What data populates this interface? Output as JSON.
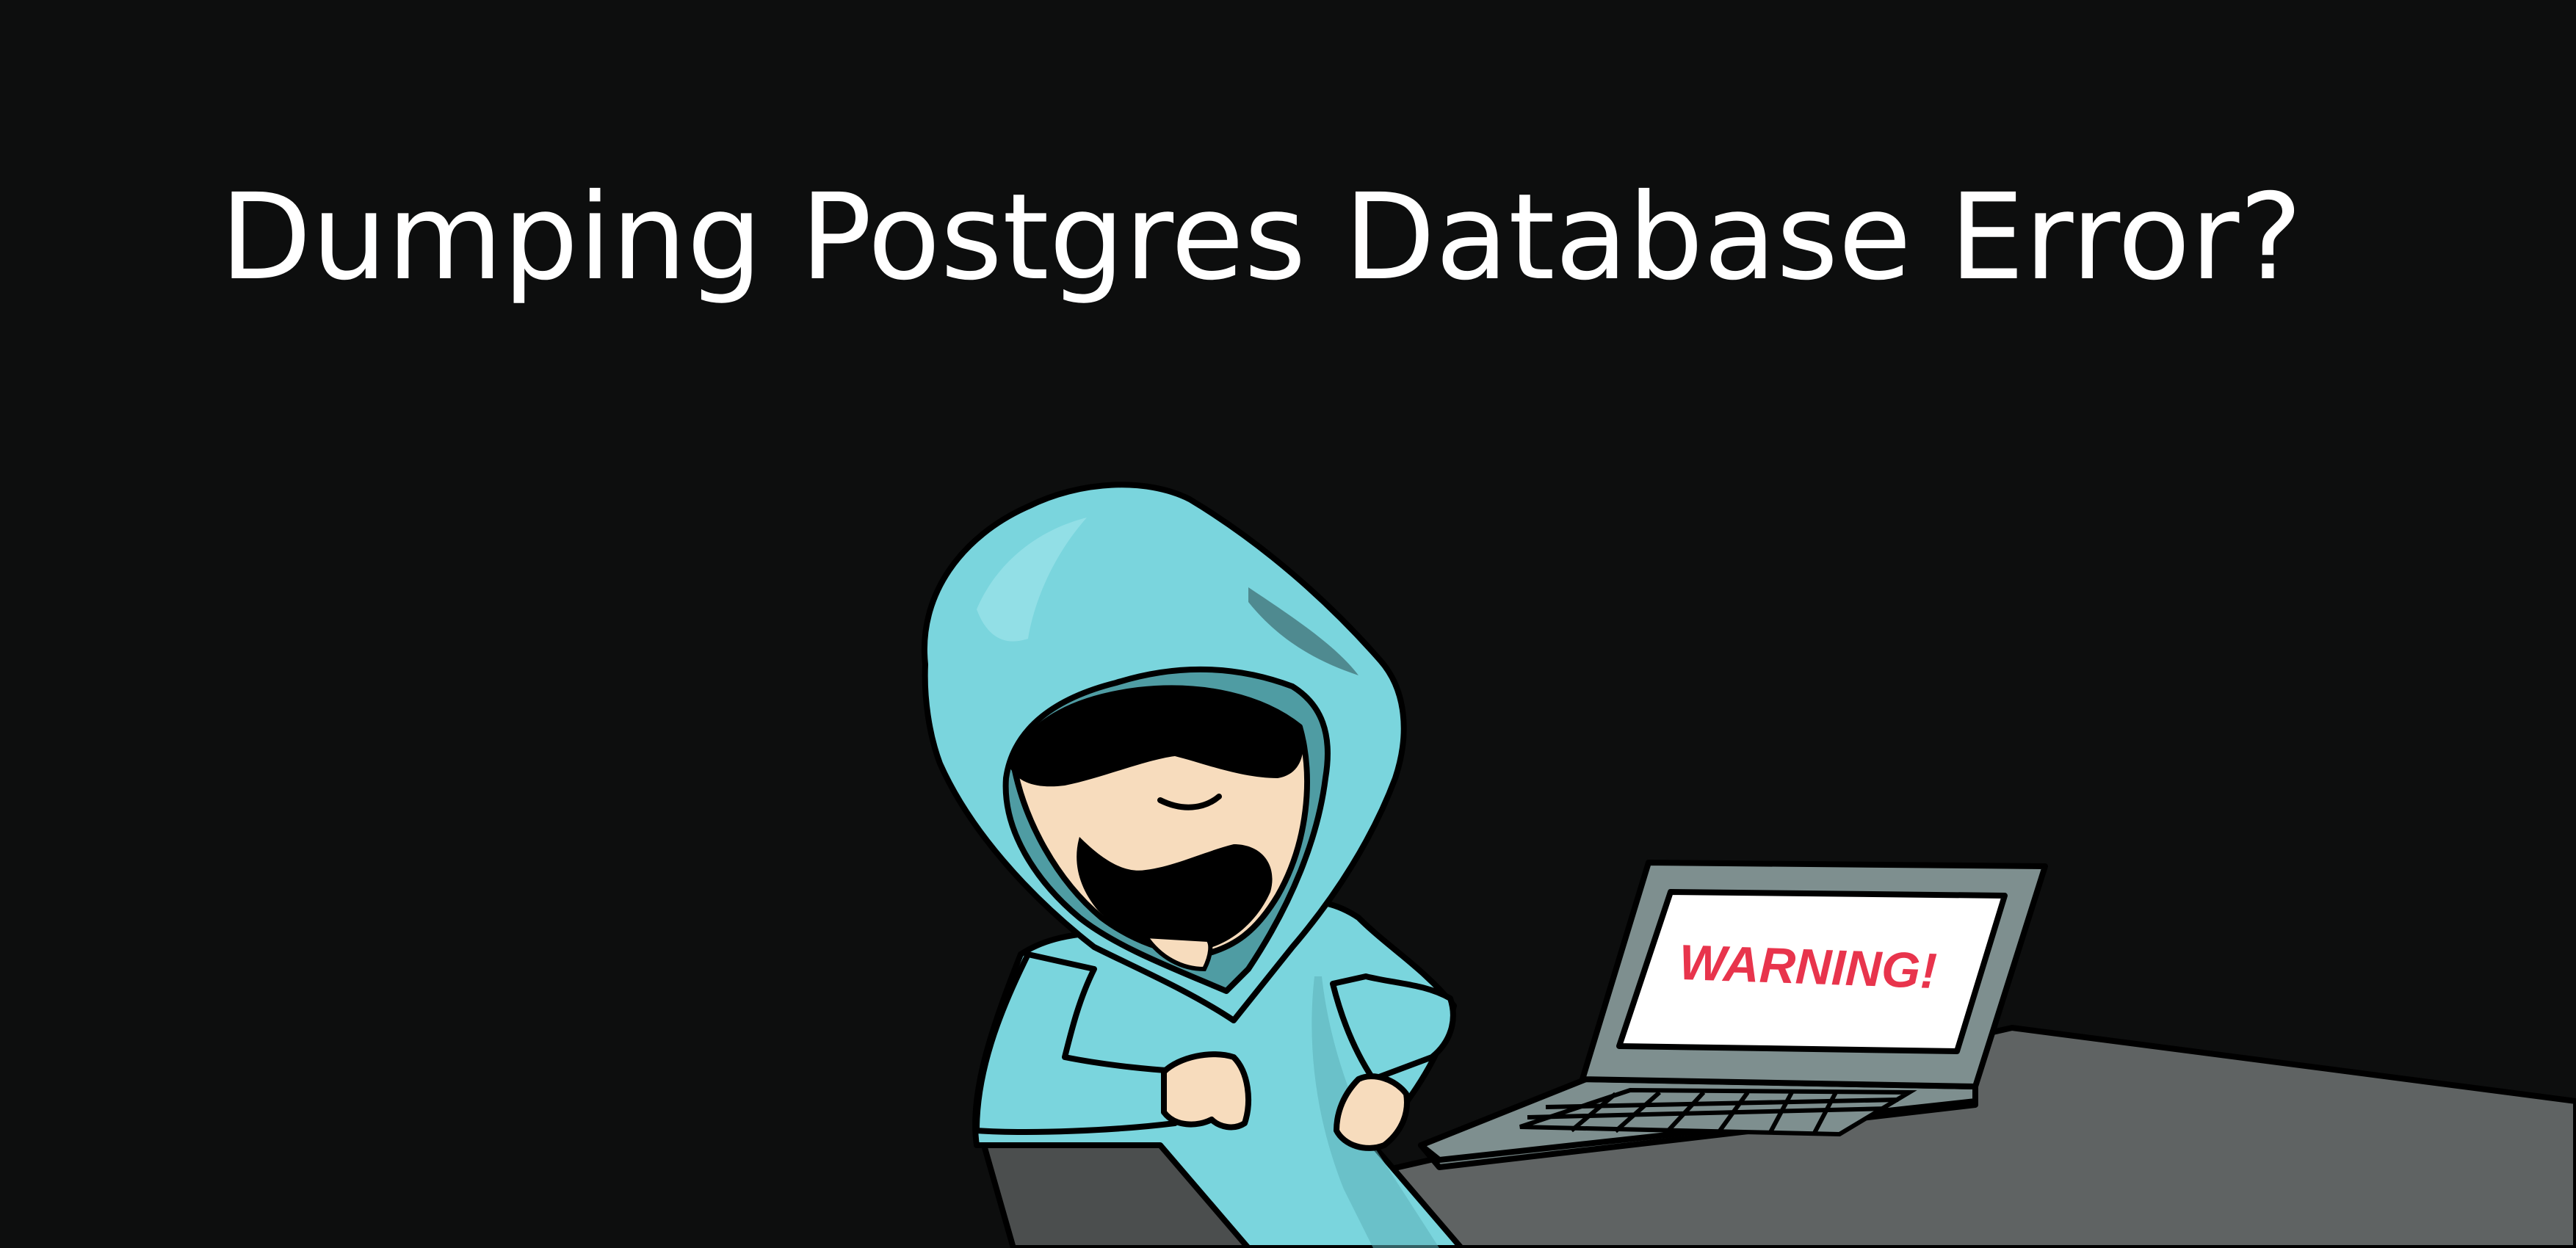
{
  "banner": {
    "title": "Dumping Postgres Database Error?",
    "laptop_screen_text": "WARNING!"
  },
  "colors": {
    "background": "#0d0e0e",
    "title_text": "#ffffff",
    "hoodie": "#7ad5dd",
    "hoodie_shadow": "#5cb0b8",
    "skin": "#f7dcbd",
    "desk": "#5f6363",
    "laptop_body": "#7e8f8f",
    "laptop_screen": "#ffffff",
    "warning_text": "#e8344c"
  },
  "icons": {
    "illustration": "hacker-at-laptop-icon"
  }
}
